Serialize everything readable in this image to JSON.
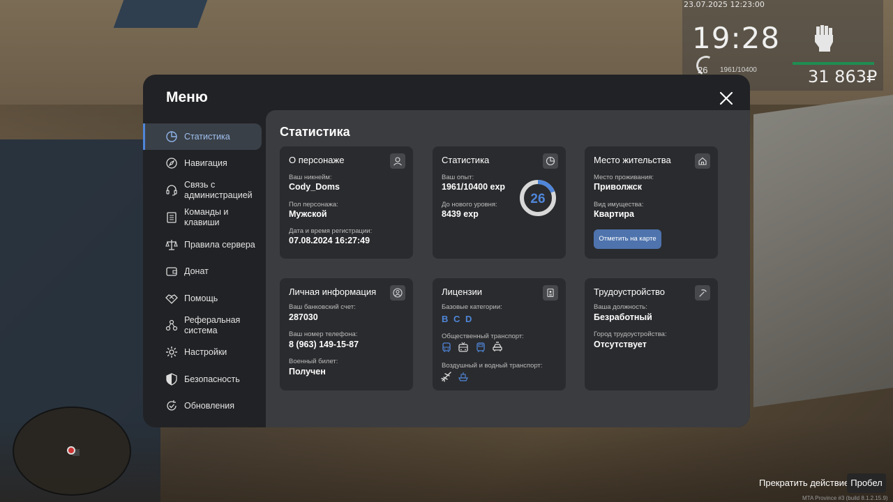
{
  "hud": {
    "date": "23.07.2025 12:23:00",
    "time": "19:28",
    "level": "26",
    "exp": "1961/10400",
    "money": "31 863₽"
  },
  "bottom": {
    "action_text": "Прекратить действие",
    "action_key": "Пробел",
    "build": "MTA Province #3 (build 8.1.2.15.9)"
  },
  "menu": {
    "title": "Меню",
    "content_title": "Статистика"
  },
  "sidebar": {
    "items": [
      {
        "label": "Статистика",
        "icon": "pie-chart-icon",
        "active": true
      },
      {
        "label": "Навигация",
        "icon": "compass-icon"
      },
      {
        "label": "Связь с администрацией",
        "icon": "headset-icon"
      },
      {
        "label": "Команды и клавиши",
        "icon": "document-icon"
      },
      {
        "label": "Правила сервера",
        "icon": "scales-icon"
      },
      {
        "label": "Донат",
        "icon": "wallet-icon"
      },
      {
        "label": "Помощь",
        "icon": "handshake-icon"
      },
      {
        "label": "Реферальная система",
        "icon": "network-icon"
      },
      {
        "label": "Настройки",
        "icon": "gear-icon"
      },
      {
        "label": "Безопасность",
        "icon": "shield-icon"
      },
      {
        "label": "Обновления",
        "icon": "refresh-check-icon"
      }
    ]
  },
  "cards": {
    "character": {
      "title": "О персонаже",
      "nick_label": "Ваш никнейм:",
      "nick": "Cody_Doms",
      "gender_label": "Пол персонажа:",
      "gender": "Мужской",
      "reg_label": "Дата и время регистрации:",
      "reg": "07.08.2024 16:27:49"
    },
    "stats": {
      "title": "Статистика",
      "exp_label": "Ваш опыт:",
      "exp": "1961/10400 exp",
      "next_label": "До нового уровня:",
      "next": "8439 exp",
      "level": "26",
      "progress": 0.189,
      "accent": "#4f86d9"
    },
    "residence": {
      "title": "Место жительства",
      "place_label": "Место проживания:",
      "place": "Приволжск",
      "type_label": "Вид имущества:",
      "type": "Квартира",
      "button": "Отметить на карте"
    },
    "personal": {
      "title": "Личная информация",
      "bank_label": "Ваш банковский счет:",
      "bank": "287030",
      "phone_label": "Ваш номер телефона:",
      "phone": "8 (963) 149-15-87",
      "military_label": "Военный билет:",
      "military": "Получен"
    },
    "licenses": {
      "title": "Лицензии",
      "base_label": "Базовые категории:",
      "categories": [
        "B",
        "C",
        "D"
      ],
      "public_label": "Общественный транспорт:",
      "air_label": "Воздушный и водный транспорт:"
    },
    "employment": {
      "title": "Трудоустройство",
      "position_label": "Ваша должность:",
      "position": "Безработный",
      "city_label": "Город трудоустройства:",
      "city": "Отсутствует"
    }
  }
}
